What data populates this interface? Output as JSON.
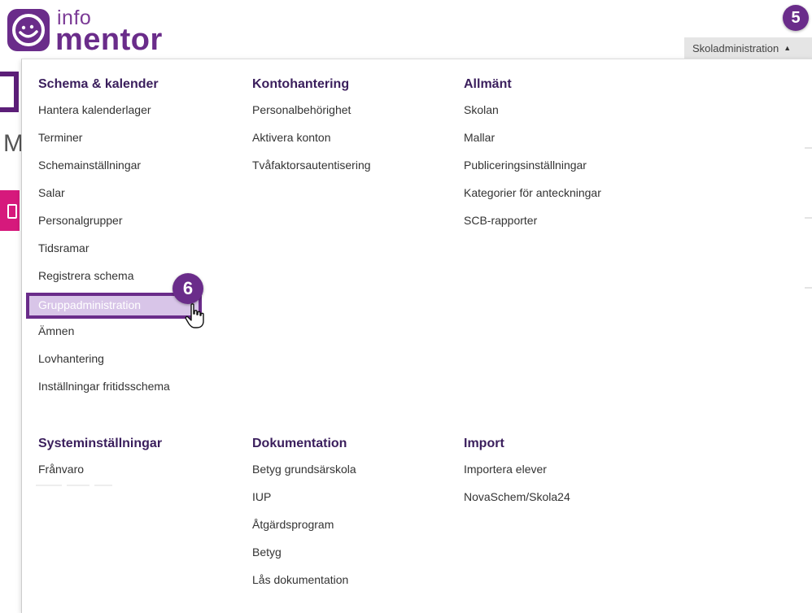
{
  "logo": {
    "line1": "info",
    "line2": "mentor"
  },
  "header": {
    "admin_menu_label": "Skoladministration",
    "admin_menu_caret": "▲",
    "step_badge_5": "5"
  },
  "background": {
    "m_letter": "M"
  },
  "step_badge_6": "6",
  "menu": {
    "schema": {
      "title": "Schema & kalender",
      "items": [
        "Hantera kalenderlager",
        "Terminer",
        "Schemainställningar",
        "Salar",
        "Personalgrupper",
        "Tidsramar",
        "Registrera schema",
        "Gruppadministration",
        "Ämnen",
        "Lovhantering",
        "Inställningar fritidsschema"
      ]
    },
    "konto": {
      "title": "Kontohantering",
      "items": [
        "Personalbehörighet",
        "Aktivera konton",
        "Tvåfaktorsautentisering"
      ]
    },
    "allmant": {
      "title": "Allmänt",
      "items": [
        "Skolan",
        "Mallar",
        "Publiceringsinställningar",
        "Kategorier för anteckningar",
        "SCB-rapporter"
      ]
    },
    "system": {
      "title": "Systeminställningar",
      "items": [
        "Frånvaro"
      ]
    },
    "dokumentation": {
      "title": "Dokumentation",
      "items": [
        "Betyg grundsärskola",
        "IUP",
        "Åtgärdsprogram",
        "Betyg",
        "Lås dokumentation"
      ]
    },
    "import": {
      "title": "Import",
      "items": [
        "Importera elever",
        "NovaSchem/Skola24"
      ]
    }
  },
  "colors": {
    "brand": "#6a2c8a",
    "highlight": "#d8c5e8",
    "heading": "#3a1e5c",
    "pink": "#d6197c"
  },
  "icons": {
    "logo": "smiley-logo-icon",
    "cursor": "hand-pointer-icon"
  }
}
